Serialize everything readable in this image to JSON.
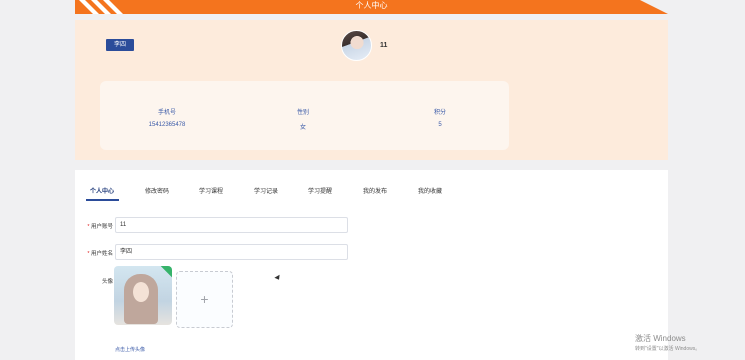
{
  "banner": {
    "title": "个人中心"
  },
  "profile": {
    "name_badge": "李四",
    "username": "11",
    "stats": [
      {
        "label": "手机号",
        "value": "15412365478"
      },
      {
        "label": "性别",
        "value": "女"
      },
      {
        "label": "积分",
        "value": "5"
      }
    ]
  },
  "tabs": [
    "个人中心",
    "修改密码",
    "学习课程",
    "学习记录",
    "学习提醒",
    "我的发布",
    "我的收藏"
  ],
  "form": {
    "account_label": "用户账号",
    "account_value": "11",
    "name_label": "用户姓名",
    "name_value": "李四",
    "avatar_label": "头像",
    "upload_hint": "点击上传头像",
    "upload_icon": "plus-icon"
  },
  "watermark": {
    "line1": "激活 Windows",
    "line2": "转到\"设置\"以激活 Windows。"
  },
  "colors": {
    "accent": "#f4741e",
    "primary": "#2b4c9a",
    "profile_bg": "#fdebdc"
  }
}
